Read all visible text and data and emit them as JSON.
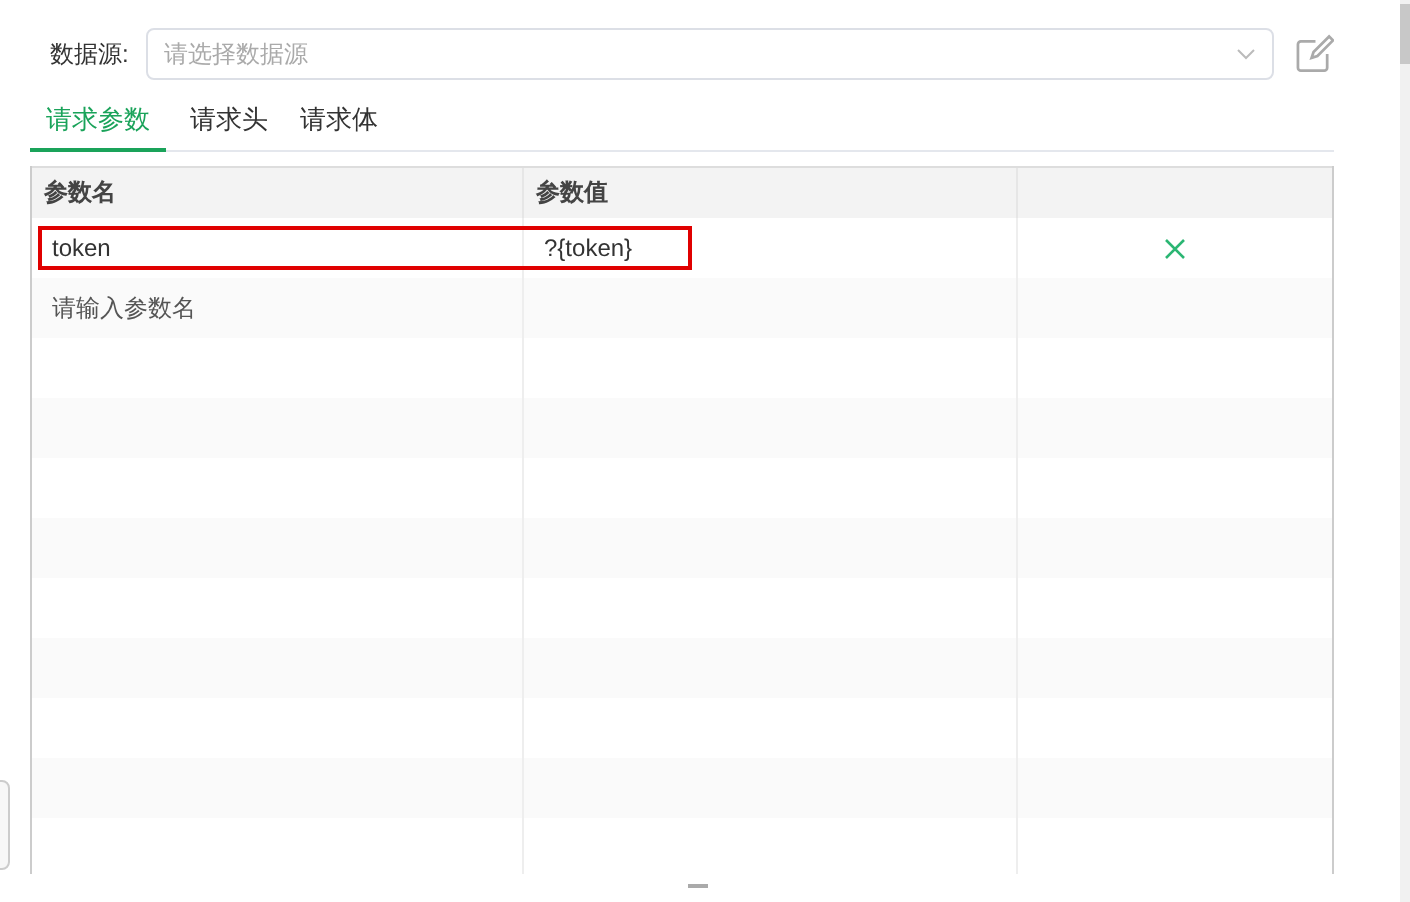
{
  "datasource": {
    "label": "数据源:",
    "placeholder": "请选择数据源"
  },
  "tabs": [
    {
      "label": "请求参数",
      "selected": true
    },
    {
      "label": "请求头",
      "selected": false
    },
    {
      "label": "请求体",
      "selected": false
    }
  ],
  "table": {
    "columns": [
      "参数名",
      "参数值"
    ],
    "rows": [
      {
        "name": "token",
        "value": "?{token}",
        "highlighted": true,
        "removable": true
      },
      {
        "name_placeholder": "请输入参数名",
        "highlighted": false,
        "removable": false
      }
    ]
  }
}
